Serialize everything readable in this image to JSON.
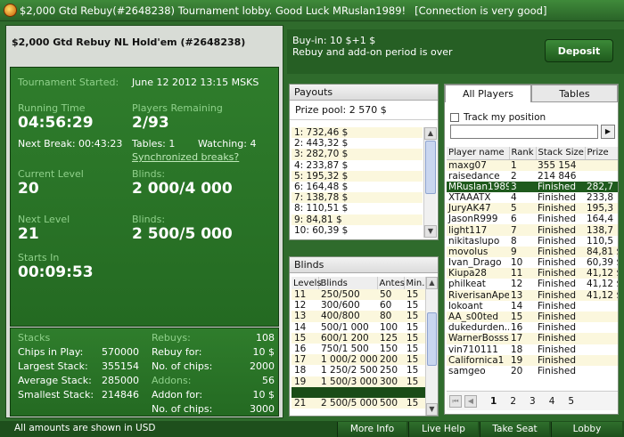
{
  "window": {
    "title": "$2,000 Gtd Rebuy(#2648238) Tournament lobby. Good Luck MRuslan1989!",
    "connection": "[Connection is very good]"
  },
  "tournament": {
    "name": "$2,000 Gtd Rebuy NL Hold'em (#2648238)",
    "started_label": "Tournament Started:",
    "started_value": "June 12 2012  13:15 MSKS",
    "running_time_label": "Running Time",
    "running_time": "04:56:29",
    "players_remaining_label": "Players Remaining",
    "players_remaining": "2/93",
    "next_break": "Next Break: 00:43:23",
    "tables": "Tables: 1",
    "watching": "Watching: 4",
    "sync_breaks": "Synchronized breaks?",
    "current_level_label": "Current Level",
    "current_level": "20",
    "blinds_label": "Blinds:",
    "current_blinds": "2 000/4 000",
    "next_level_label": "Next Level",
    "next_level": "21",
    "next_blinds_label": "Blinds:",
    "next_blinds": "2 500/5 000",
    "starts_in_label": "Starts In",
    "starts_in": "00:09:53"
  },
  "stacks": {
    "title": "Stacks",
    "chips_in_play_label": "Chips in Play:",
    "chips_in_play": "570000",
    "largest_label": "Largest Stack:",
    "largest": "355154",
    "average_label": "Average Stack:",
    "average": "285000",
    "smallest_label": "Smallest Stack:",
    "smallest": "214846",
    "rebuys_label": "Rebuys:",
    "rebuys": "108",
    "rebuy_for_label": "Rebuy for:",
    "rebuy_for": "10 $",
    "rebuy_chips_label": "No. of chips:",
    "rebuy_chips": "2000",
    "addons_label": "Addons:",
    "addons": "56",
    "addon_for_label": "Addon for:",
    "addon_for": "10 $",
    "addon_chips_label": "No. of chips:",
    "addon_chips": "3000"
  },
  "buyin": {
    "line1": "Buy-in: 10 $+1 $",
    "line2": "Rebuy and add-on period is over",
    "deposit_label": "Deposit"
  },
  "payouts": {
    "title": "Payouts",
    "prize_pool": "Prize pool: 2 570 $",
    "rows": [
      "1: 732,46 $",
      "2: 443,32 $",
      "3: 282,70 $",
      "4: 233,87 $",
      "5: 195,32 $",
      "6: 164,48 $",
      "7: 138,78 $",
      "8: 110,51 $",
      "9: 84,81 $",
      "10: 60,39 $"
    ]
  },
  "blinds": {
    "title": "Blinds",
    "headers": [
      "Levels",
      "Blinds",
      "Antes",
      "Min."
    ],
    "rows": [
      [
        "11",
        "250/500",
        "50",
        "15"
      ],
      [
        "12",
        "300/600",
        "60",
        "15"
      ],
      [
        "13",
        "400/800",
        "80",
        "15"
      ],
      [
        "14",
        "500/1 000",
        "100",
        "15"
      ],
      [
        "15",
        "600/1 200",
        "125",
        "15"
      ],
      [
        "16",
        "750/1 500",
        "150",
        "15"
      ],
      [
        "17",
        "1 000/2 000",
        "200",
        "15"
      ],
      [
        "18",
        "1 250/2 500",
        "250",
        "15"
      ],
      [
        "19",
        "1 500/3 000",
        "300",
        "15"
      ],
      [
        "",
        "",
        "",
        ""
      ],
      [
        "21",
        "2 500/5 000",
        "500",
        "15"
      ]
    ]
  },
  "players": {
    "tab_all": "All Players",
    "tab_tables": "Tables",
    "track_label": "Track my position",
    "headers": [
      "Player name",
      "Rank",
      "Stack Size",
      "Prize"
    ],
    "rows": [
      [
        "maxg07",
        "1",
        "355 154",
        ""
      ],
      [
        "raisedance",
        "2",
        "214 846",
        ""
      ],
      [
        "MRuslan1989",
        "3",
        "Finished",
        "282,7"
      ],
      [
        "XTAAATX",
        "4",
        "Finished",
        "233,8"
      ],
      [
        "JuryAK47",
        "5",
        "Finished",
        "195,3"
      ],
      [
        "JasonR999",
        "6",
        "Finished",
        "164,4"
      ],
      [
        "light117",
        "7",
        "Finished",
        "138,7"
      ],
      [
        "nikitaslupo",
        "8",
        "Finished",
        "110,5"
      ],
      [
        "movolus",
        "9",
        "Finished",
        "84,81 $"
      ],
      [
        "Ivan_Drago",
        "10",
        "Finished",
        "60,39 $"
      ],
      [
        "Kiupa28",
        "11",
        "Finished",
        "41,12 $"
      ],
      [
        "philkeat",
        "12",
        "Finished",
        "41,12 $"
      ],
      [
        "RiverisanApe",
        "13",
        "Finished",
        "41,12 $"
      ],
      [
        "lokoant",
        "14",
        "Finished",
        ""
      ],
      [
        "AA_s00ted",
        "15",
        "Finished",
        ""
      ],
      [
        "dukedurden...",
        "16",
        "Finished",
        ""
      ],
      [
        "WarnerBosss",
        "17",
        "Finished",
        ""
      ],
      [
        "vin710111",
        "18",
        "Finished",
        ""
      ],
      [
        "Californica1",
        "19",
        "Finished",
        ""
      ],
      [
        "samgeo",
        "20",
        "Finished",
        ""
      ]
    ],
    "pages": [
      "1",
      "2",
      "3",
      "4",
      "5"
    ]
  },
  "footer": {
    "note": "All amounts are shown in USD",
    "more_info": "More Info",
    "live_help": "Live Help",
    "take_seat": "Take Seat",
    "lobby": "Lobby"
  }
}
